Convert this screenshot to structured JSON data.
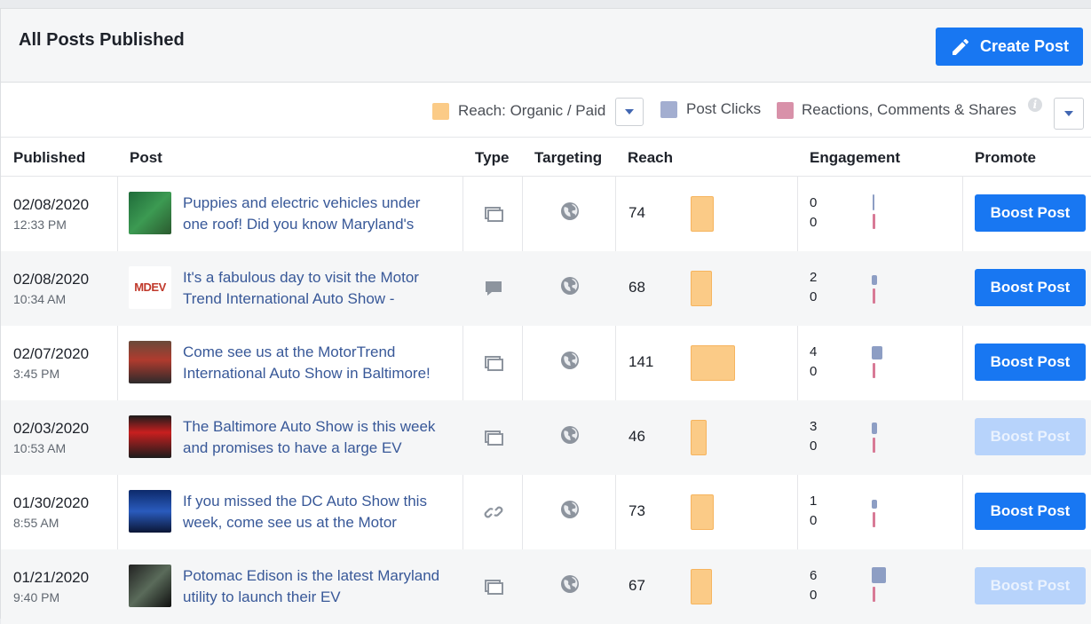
{
  "header": {
    "title": "All Posts Published",
    "create_label": "Create Post"
  },
  "legend": {
    "reach_label": "Reach: Organic / Paid",
    "clicks_label": "Post Clicks",
    "reactions_label": "Reactions, Comments & Shares",
    "info_glyph": "i",
    "colors": {
      "reach": "#fbcb87",
      "clicks": "#a3aed0",
      "reactions": "#d891a9"
    }
  },
  "columns": {
    "published": "Published",
    "post": "Post",
    "type": "Type",
    "targeting": "Targeting",
    "reach": "Reach",
    "engagement": "Engagement",
    "promote": "Promote"
  },
  "rows": [
    {
      "date": "02/08/2020",
      "time": "12:33 PM",
      "text": "Puppies and electric vehicles under one roof! Did you know Maryland's",
      "type_icon": "album-icon",
      "reach": "74",
      "clicks": "0",
      "reactions": "0",
      "boost": "Boost Post",
      "boost_enabled": true,
      "thumb": "green-photo"
    },
    {
      "date": "02/08/2020",
      "time": "10:34 AM",
      "text": "It's a fabulous day to visit the Motor Trend International Auto Show -",
      "type_icon": "status-icon",
      "reach": "68",
      "clicks": "2",
      "reactions": "0",
      "boost": "Boost Post",
      "boost_enabled": true,
      "thumb": "mdev-logo",
      "thumb_text": "MDEV"
    },
    {
      "date": "02/07/2020",
      "time": "3:45 PM",
      "text": "Come see us at the MotorTrend International Auto Show in Baltimore!",
      "type_icon": "album-icon",
      "reach": "141",
      "clicks": "4",
      "reactions": "0",
      "boost": "Boost Post",
      "boost_enabled": true,
      "thumb": "people-photo"
    },
    {
      "date": "02/03/2020",
      "time": "10:53 AM",
      "text": "The Baltimore Auto Show is this week and promises to have a large EV",
      "type_icon": "album-icon",
      "reach": "46",
      "clicks": "3",
      "reactions": "0",
      "boost": "Boost Post",
      "boost_enabled": false,
      "thumb": "red-poster"
    },
    {
      "date": "01/30/2020",
      "time": "8:55 AM",
      "text": "If you missed the DC Auto Show this week, come see us at the Motor",
      "type_icon": "link-icon",
      "reach": "73",
      "clicks": "1",
      "reactions": "0",
      "boost": "Boost Post",
      "boost_enabled": true,
      "thumb": "blue-photo"
    },
    {
      "date": "01/21/2020",
      "time": "9:40 PM",
      "text": "Potomac Edison is the latest Maryland utility to launch their EV",
      "type_icon": "album-icon",
      "reach": "67",
      "clicks": "6",
      "reactions": "0",
      "boost": "Boost Post",
      "boost_enabled": false,
      "thumb": "charger-photo"
    }
  ]
}
